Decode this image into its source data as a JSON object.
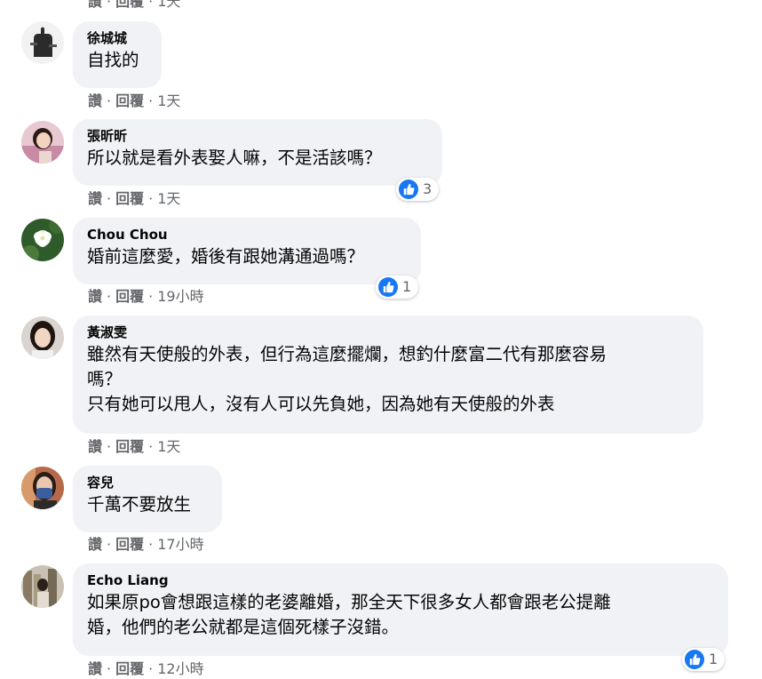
{
  "top_partial": {
    "like": "讚",
    "reply": "回覆",
    "time": "1天"
  },
  "comments": [
    {
      "author": "徐城城",
      "lines": [
        "自找的"
      ],
      "like": "讚",
      "reply": "回覆",
      "time": "1天"
    },
    {
      "author": "張昕昕",
      "lines": [
        "所以就是看外表娶人嘛，不是活該嗎？"
      ],
      "like": "讚",
      "reply": "回覆",
      "time": "1天",
      "reactions": "3"
    },
    {
      "author": "Chou Chou",
      "lines": [
        "婚前這麼愛，婚後有跟她溝通過嗎？"
      ],
      "like": "讚",
      "reply": "回覆",
      "time": "19小時",
      "reactions": "1"
    },
    {
      "author": "黃淑雯",
      "lines": [
        "雖然有天使般的外表，但行為這麼擺爛，想釣什麼富二代有那麼容易",
        "嗎？",
        "只有她可以甩人，沒有人可以先負她，因為她有天使般的外表"
      ],
      "like": "讚",
      "reply": "回覆",
      "time": "1天"
    },
    {
      "author": "容兒",
      "lines": [
        "千萬不要放生"
      ],
      "like": "讚",
      "reply": "回覆",
      "time": "17小時"
    },
    {
      "author": "Echo Liang",
      "lines": [
        "如果原po會想跟這樣的老婆離婚，那全天下很多女人都會跟老公提離",
        "婚，他們的老公就都是這個死樣子沒錯。"
      ],
      "like": "讚",
      "reply": "回覆",
      "time": "12小時",
      "reactions": "1"
    }
  ],
  "colors": {
    "bubble": "#f0f2f5",
    "meta": "#65676b",
    "like_blue": "#1877f2"
  },
  "icons": {
    "reaction": "thumbs-up-icon"
  }
}
